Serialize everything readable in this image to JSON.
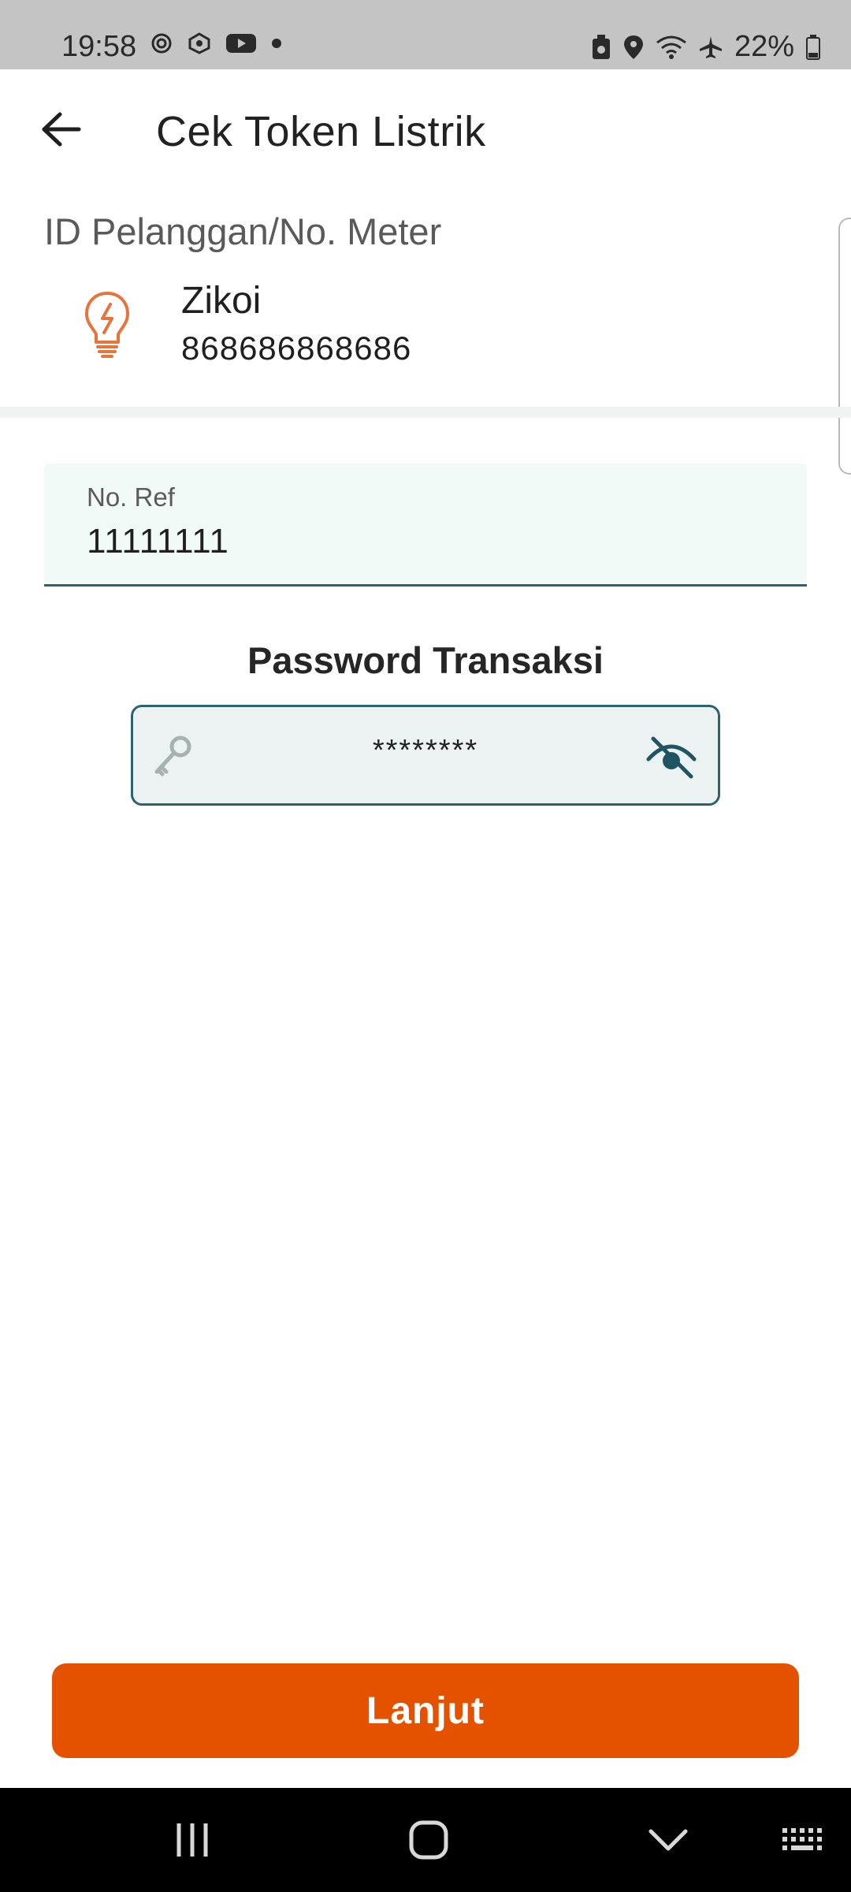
{
  "status_bar": {
    "time": "19:58",
    "battery": "22%",
    "left_icons": [
      "settings-icon",
      "sync-icon",
      "youtube-icon",
      "dot-icon"
    ],
    "right_icons": [
      "battery-saver-icon",
      "location-icon",
      "wifi-icon",
      "airplane-icon",
      "battery-icon"
    ]
  },
  "header": {
    "title": "Cek Token Listrik",
    "back_icon": "arrow-left-icon"
  },
  "customer": {
    "section_label": "ID Pelanggan/No. Meter",
    "name": "Zikoi",
    "meter_number": "868686868686",
    "icon": "lightbulb-icon"
  },
  "ref_field": {
    "label": "No. Ref",
    "value": "11111111"
  },
  "password": {
    "heading": "Password Transaksi",
    "value": "********",
    "icons": [
      "key-icon",
      "eye-off-icon"
    ]
  },
  "action": {
    "button_label": "Lanjut"
  },
  "colors": {
    "accent_orange": "#e45200",
    "field_border_teal": "#2d6270",
    "field_bg": "#f1faf7",
    "password_bg": "#ebf2f1"
  }
}
